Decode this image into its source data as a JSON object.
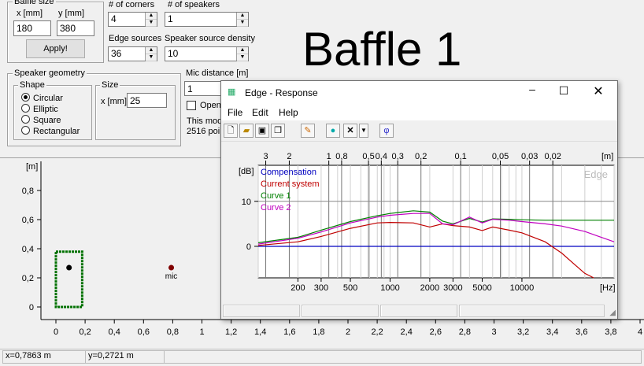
{
  "baffle_size": {
    "title": "Baffle size",
    "x_label": "x [mm]",
    "y_label": "y [mm]",
    "x_value": "180",
    "y_value": "380",
    "apply_label": "Apply!"
  },
  "corners": {
    "label": "# of corners",
    "value": "4"
  },
  "speakers": {
    "label": "# of speakers",
    "value": "1"
  },
  "edge_sources": {
    "label": "Edge sources",
    "value": "36"
  },
  "source_density": {
    "label": "Speaker source density",
    "value": "10"
  },
  "baffle_title": "Baffle 1",
  "geometry": {
    "title": "Speaker geometry",
    "shape_title": "Shape",
    "shapes": [
      "Circular",
      "Elliptic",
      "Square",
      "Rectangular"
    ],
    "selected": "Circular",
    "size_title": "Size",
    "size_label": "x [mm]",
    "size_value": "25"
  },
  "mic": {
    "label": "Mic distance [m]",
    "value": "1",
    "open_label": "Open",
    "info1": "This mod",
    "info2": "2516 poi"
  },
  "baffle_plot": {
    "unit": "[m]",
    "mic_label": "mic",
    "y_ticks": [
      "0,8",
      "0,6",
      "0,4",
      "0,2",
      "0"
    ],
    "x_ticks": [
      "0",
      "0,2",
      "0,4",
      "0,6",
      "0,8",
      "1",
      "1,2",
      "1,4",
      "1,6",
      "1,8",
      "2",
      "2,2",
      "2,4",
      "2,6",
      "2,8",
      "3",
      "3,2",
      "3,4",
      "3,6",
      "3,8",
      "4"
    ]
  },
  "statusbar": {
    "x": "x=0,7863 m",
    "y": "y=0,2721 m"
  },
  "response_window": {
    "title": "Edge - Response",
    "menus": [
      "File",
      "Edit",
      "Help"
    ],
    "toolbar": [
      "new-icon",
      "open-icon",
      "save-icon",
      "copy-icon",
      "pen-icon",
      "color-icon",
      "delete-icon",
      "phi-icon"
    ],
    "phi": "φ",
    "watermark": "Edge"
  },
  "chart_data": {
    "type": "line",
    "ylabel": "[dB]",
    "xlabel": "[Hz]",
    "top_unit": "[m]",
    "x_scale": "log",
    "xlim": [
      100,
      50000
    ],
    "ylim": [
      -7,
      18
    ],
    "y_ticks": [
      0,
      10
    ],
    "x_tick_labels": [
      {
        "v": 200,
        "t": "200"
      },
      {
        "v": 300,
        "t": "300"
      },
      {
        "v": 500,
        "t": "500"
      },
      {
        "v": 1000,
        "t": "1000"
      },
      {
        "v": 2000,
        "t": "2000"
      },
      {
        "v": 3000,
        "t": "3000"
      },
      {
        "v": 5000,
        "t": "5000"
      },
      {
        "v": 10000,
        "t": "10000"
      }
    ],
    "top_tick_labels": [
      {
        "v": 114,
        "t": "3"
      },
      {
        "v": 172,
        "t": "2"
      },
      {
        "v": 343,
        "t": "1"
      },
      {
        "v": 429,
        "t": "0,8"
      },
      {
        "v": 686,
        "t": "0,5"
      },
      {
        "v": 858,
        "t": "0,4"
      },
      {
        "v": 1143,
        "t": "0,3"
      },
      {
        "v": 1715,
        "t": "0,2"
      },
      {
        "v": 3430,
        "t": "0,1"
      },
      {
        "v": 6860,
        "t": "0,05"
      },
      {
        "v": 11433,
        "t": "0,03"
      },
      {
        "v": 17150,
        "t": "0,02"
      }
    ],
    "grid": true,
    "legend_position": "top-left",
    "series": [
      {
        "name": "Compensation",
        "color": "#0000c0",
        "x": [
          100,
          50000
        ],
        "y": [
          0,
          0
        ]
      },
      {
        "name": "Current system",
        "color": "#c00000",
        "x": [
          100,
          200,
          300,
          500,
          800,
          1000,
          1500,
          2000,
          2500,
          3000,
          4000,
          5000,
          6000,
          8000,
          10000,
          15000,
          20000,
          25000,
          30000,
          35000
        ],
        "y": [
          0.2,
          1.0,
          2.2,
          4.0,
          5.2,
          5.3,
          5.2,
          4.3,
          5.0,
          4.6,
          4.3,
          3.5,
          4.3,
          3.6,
          3.0,
          1.0,
          -1.5,
          -4.0,
          -6.0,
          -7.0
        ]
      },
      {
        "name": "Curve 1",
        "color": "#008000",
        "x": [
          100,
          200,
          300,
          500,
          800,
          1000,
          1500,
          2000,
          2500,
          3000,
          4000,
          5000,
          6000,
          8000,
          10000,
          15000,
          20000,
          30000,
          50000
        ],
        "y": [
          0.8,
          2.0,
          3.6,
          5.5,
          6.8,
          7.3,
          7.9,
          7.6,
          5.6,
          5.0,
          6.2,
          5.4,
          6.1,
          6.0,
          5.9,
          5.8,
          5.8,
          5.8,
          5.8
        ]
      },
      {
        "name": "Curve 2",
        "color": "#c000c0",
        "x": [
          100,
          200,
          300,
          500,
          800,
          1000,
          1500,
          2000,
          2500,
          3000,
          4000,
          5000,
          6000,
          8000,
          10000,
          15000,
          20000,
          30000,
          50000
        ],
        "y": [
          0.5,
          1.8,
          3.2,
          5.2,
          6.5,
          6.9,
          7.3,
          7.3,
          5.0,
          4.8,
          6.5,
          5.2,
          6.0,
          5.8,
          5.5,
          5.0,
          4.5,
          3.3,
          1.0
        ]
      }
    ]
  }
}
